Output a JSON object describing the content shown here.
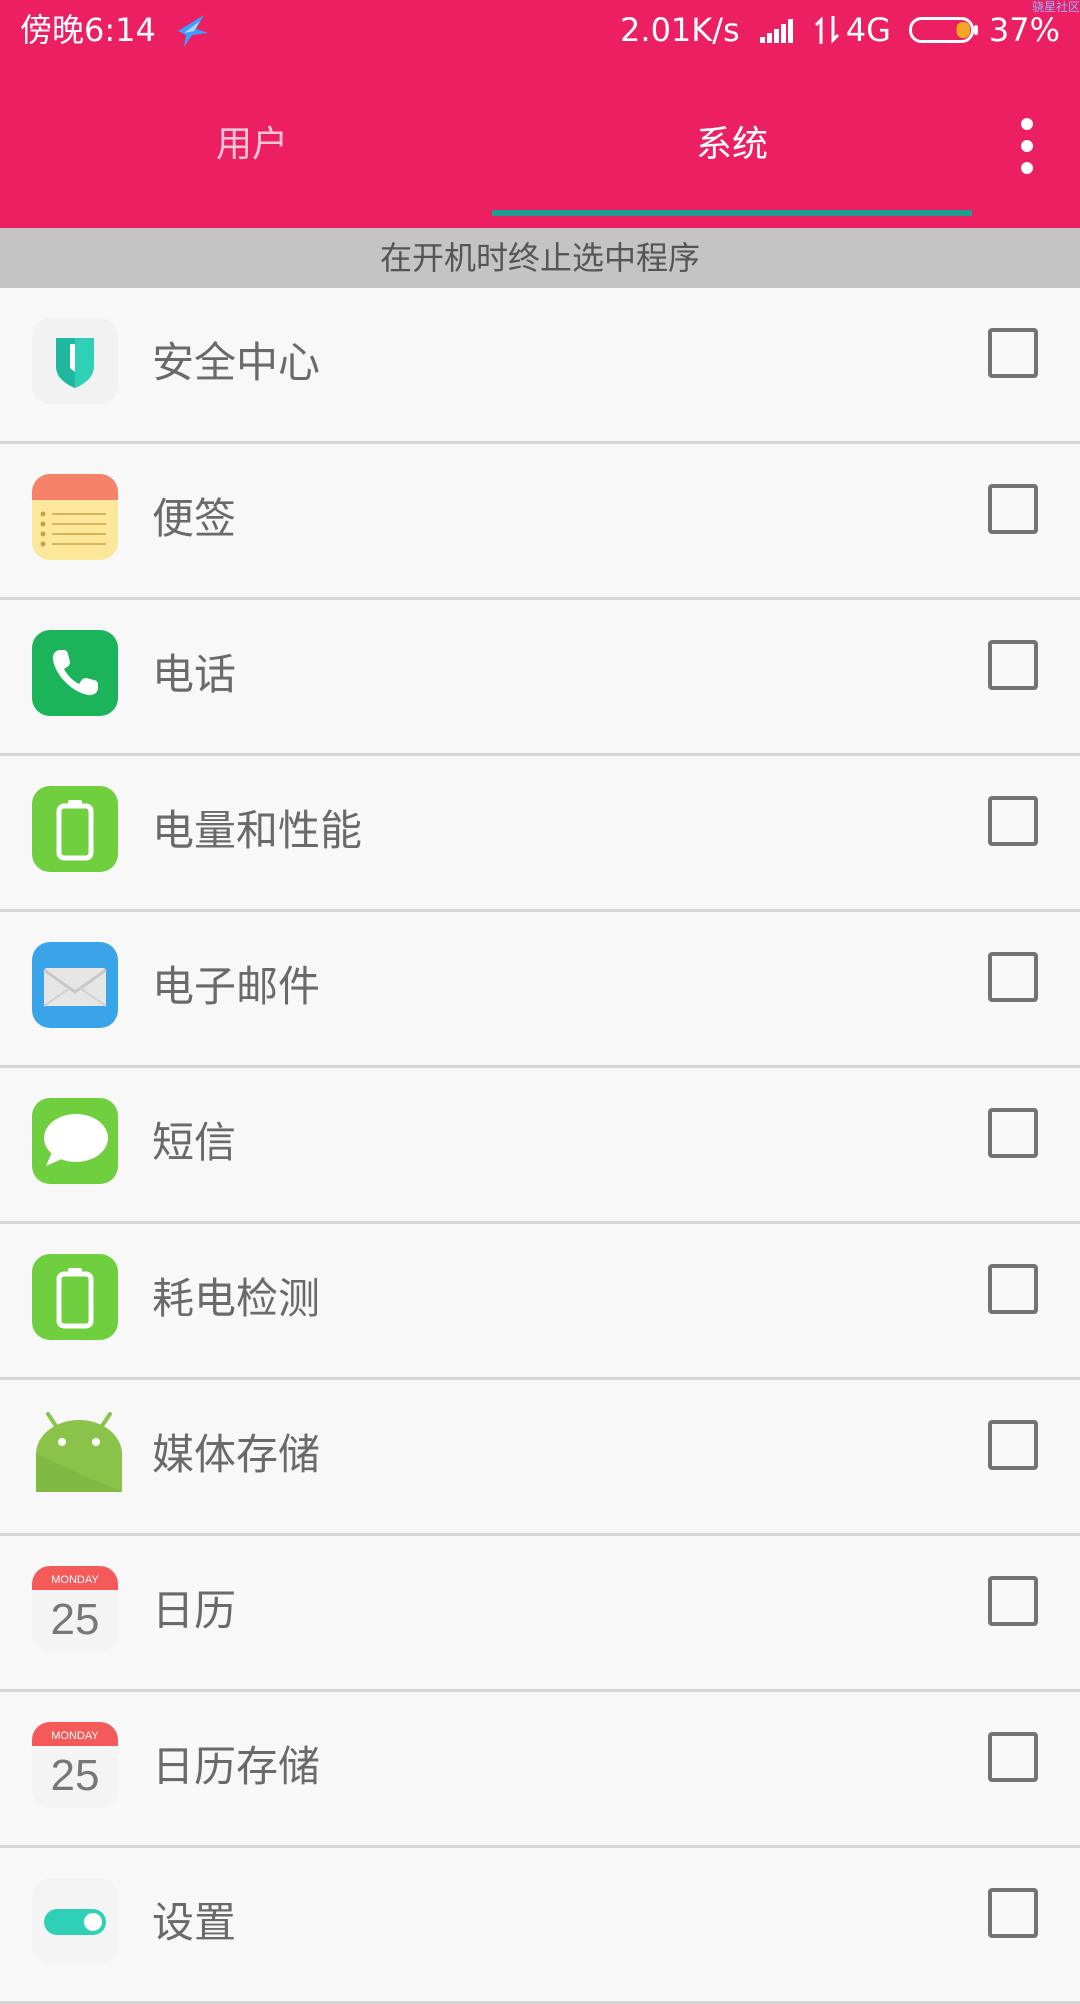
{
  "status_bar": {
    "time": "傍晚6:14",
    "network_speed": "2.01K/s",
    "network_type": "4G",
    "battery_percent": "37%",
    "battery_level": 0.37,
    "watermark": "骁星社区"
  },
  "tabs": [
    {
      "label": "用户",
      "selected": false
    },
    {
      "label": "系统",
      "selected": true
    }
  ],
  "section_header": "在开机时终止选中程序",
  "apps": [
    {
      "label": "安全中心",
      "icon": "shield-icon",
      "checked": false
    },
    {
      "label": "便签",
      "icon": "notes-icon",
      "checked": false
    },
    {
      "label": "电话",
      "icon": "phone-icon",
      "checked": false
    },
    {
      "label": "电量和性能",
      "icon": "battery-icon",
      "checked": false
    },
    {
      "label": "电子邮件",
      "icon": "email-icon",
      "checked": false
    },
    {
      "label": "短信",
      "icon": "message-icon",
      "checked": false
    },
    {
      "label": "耗电检测",
      "icon": "battery-icon",
      "checked": false
    },
    {
      "label": "媒体存储",
      "icon": "android-icon",
      "checked": false
    },
    {
      "label": "日历",
      "icon": "calendar-icon",
      "checked": false,
      "calendar_day": "MONDAY",
      "calendar_date": "25"
    },
    {
      "label": "日历存储",
      "icon": "calendar-icon",
      "checked": false,
      "calendar_day": "MONDAY",
      "calendar_date": "25"
    },
    {
      "label": "设置",
      "icon": "toggle-icon",
      "checked": false
    }
  ],
  "colors": {
    "accent": "#ec1f63",
    "tab_indicator": "#1e9e8e",
    "section_bg": "#c4c4c4",
    "list_bg": "#f8f8f8"
  }
}
